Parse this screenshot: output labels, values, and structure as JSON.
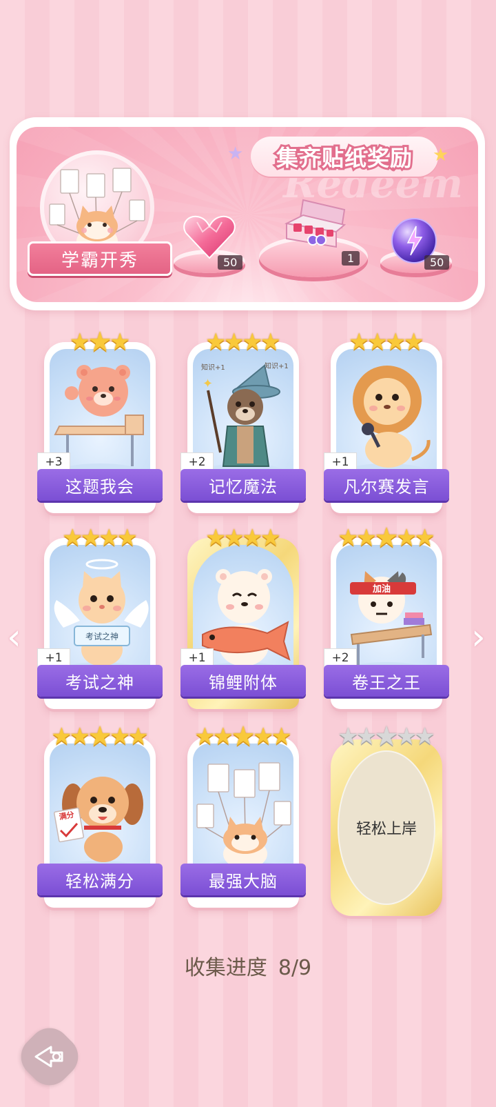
{
  "reward_banner": {
    "title": "集齐贴纸奖励",
    "watermark": "Redeem",
    "avatar_label": "学霸开秀",
    "rewards": [
      {
        "icon": "pink-heart-gem-icon",
        "count": "50"
      },
      {
        "icon": "gift-box-icon",
        "count": "1"
      },
      {
        "icon": "purple-lightning-orb-icon",
        "count": "50"
      }
    ]
  },
  "cards": [
    {
      "name": "这题我会",
      "stars": 3,
      "bonus": "+3",
      "art": "bear-at-desk",
      "owned": true
    },
    {
      "name": "记忆魔法",
      "stars": 4,
      "bonus": "+2",
      "art": "wizard-otter",
      "owned": true
    },
    {
      "name": "凡尔赛发言",
      "stars": 4,
      "bonus": "+1",
      "art": "lion-microphone",
      "owned": true
    },
    {
      "name": "考试之神",
      "stars": 4,
      "bonus": "+1",
      "art": "angel-cat",
      "sign": "考试之神",
      "owned": true
    },
    {
      "name": "锦鲤附体",
      "stars": 4,
      "bonus": "+1",
      "art": "bear-with-koi",
      "owned": true,
      "gold": true
    },
    {
      "name": "卷王之王",
      "stars": 5,
      "bonus": "+2",
      "art": "studying-cat",
      "headband": "加油",
      "owned": true
    },
    {
      "name": "轻松满分",
      "stars": 5,
      "bonus": "",
      "art": "puppy-full-marks",
      "sign": "满分",
      "owned": true
    },
    {
      "name": "最强大脑",
      "stars": 5,
      "bonus": "",
      "art": "cat-with-papers",
      "owned": true
    },
    {
      "name": "轻松上岸",
      "stars": 5,
      "bonus": "",
      "art": "locked",
      "owned": false
    }
  ],
  "progress": {
    "label": "收集进度",
    "value": "8/9"
  },
  "nav": {
    "prev_icon": "chevron-left-icon",
    "next_icon": "chevron-right-icon",
    "back_icon": "back-arrow-icon"
  }
}
